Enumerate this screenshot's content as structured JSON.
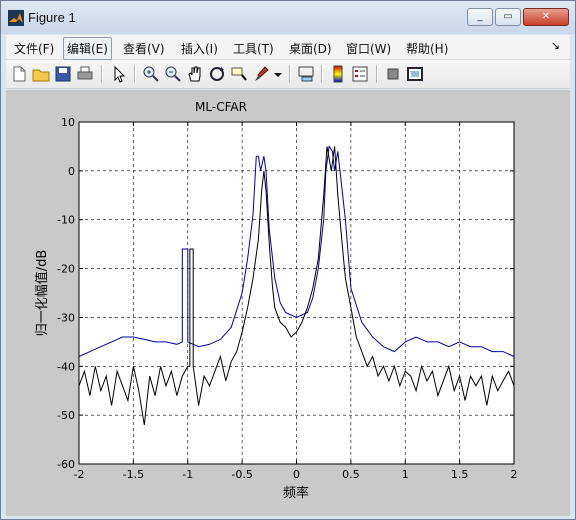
{
  "window": {
    "title": "Figure 1",
    "minimize_label": "_",
    "maximize_label": "▭",
    "close_label": "✕"
  },
  "menubar": {
    "items": [
      "文件(F)",
      "编辑(E)",
      "查看(V)",
      "插入(I)",
      "工具(T)",
      "桌面(D)",
      "窗口(W)",
      "帮助(H)"
    ],
    "active_item": "编辑(E)",
    "corner_glyph": "↘"
  },
  "toolbar": {
    "buttons": [
      "new-figure",
      "open-file",
      "save",
      "print",
      "edit-plot",
      "zoom-in",
      "zoom-out",
      "pan",
      "rotate-3d",
      "data-cursor",
      "brush",
      "brush-dropdown",
      "link-plot",
      "insert-colorbar",
      "insert-legend",
      "hide-plot-tools",
      "show-plot-tools"
    ]
  },
  "colors": {
    "series_blue": "#0000a8",
    "series_black": "#000000",
    "figure_background": "#c9c9c9",
    "axes_background": "#ffffff"
  },
  "chart_data": {
    "type": "line",
    "title": "ML-CFAR",
    "xlabel": "频率",
    "ylabel": "归一化幅值/dB",
    "xlim": [
      -2,
      2
    ],
    "ylim": [
      -60,
      10
    ],
    "xticks": [
      "-2",
      "-1.5",
      "-1",
      "-0.5",
      "0",
      "0.5",
      "1",
      "1.5",
      "2"
    ],
    "yticks": [
      "10",
      "0",
      "-10",
      "-20",
      "-30",
      "-40",
      "-50",
      "-60"
    ],
    "grid": true,
    "grid_style": "dashed",
    "series": [
      {
        "color": "blue",
        "x": [
          -2.0,
          -1.9,
          -1.8,
          -1.7,
          -1.6,
          -1.5,
          -1.4,
          -1.3,
          -1.2,
          -1.1,
          -1.05,
          -1.05,
          -1.0,
          -1.0,
          -0.9,
          -0.8,
          -0.7,
          -0.6,
          -0.5,
          -0.45,
          -0.4,
          -0.37,
          -0.35,
          -0.33,
          -0.3,
          -0.28,
          -0.25,
          -0.2,
          -0.15,
          -0.1,
          0.0,
          0.1,
          0.15,
          0.2,
          0.25,
          0.27,
          0.3,
          0.33,
          0.35,
          0.38,
          0.4,
          0.45,
          0.5,
          0.6,
          0.7,
          0.8,
          0.9,
          1.0,
          1.1,
          1.2,
          1.3,
          1.4,
          1.5,
          1.6,
          1.7,
          1.8,
          1.9,
          2.0
        ],
        "y": [
          -38,
          -37,
          -36,
          -35,
          -34,
          -34,
          -34.5,
          -35,
          -35,
          -35.5,
          -35,
          -16,
          -16,
          -35,
          -36,
          -35.5,
          -34.5,
          -32,
          -25,
          -18,
          -9,
          3,
          3,
          0,
          3,
          0,
          -12,
          -22,
          -27,
          -29,
          -30,
          -29,
          -26,
          -20,
          -10,
          0,
          5,
          4,
          0,
          4,
          0,
          -10,
          -24,
          -31,
          -34,
          -36,
          -37,
          -35,
          -34,
          -35,
          -35,
          -36,
          -35,
          -36,
          -36,
          -37,
          -37,
          -38
        ]
      },
      {
        "color": "black",
        "x": [
          -2.0,
          -1.95,
          -1.9,
          -1.85,
          -1.8,
          -1.75,
          -1.7,
          -1.65,
          -1.6,
          -1.55,
          -1.5,
          -1.45,
          -1.4,
          -1.35,
          -1.3,
          -1.25,
          -1.2,
          -1.15,
          -1.1,
          -1.05,
          -1.0,
          -0.98,
          -0.98,
          -0.95,
          -0.95,
          -0.9,
          -0.85,
          -0.8,
          -0.75,
          -0.7,
          -0.65,
          -0.6,
          -0.55,
          -0.5,
          -0.45,
          -0.4,
          -0.35,
          -0.32,
          -0.3,
          -0.28,
          -0.25,
          -0.22,
          -0.2,
          -0.15,
          -0.1,
          -0.05,
          0.0,
          0.05,
          0.1,
          0.15,
          0.2,
          0.25,
          0.28,
          0.32,
          0.35,
          0.38,
          0.42,
          0.45,
          0.5,
          0.55,
          0.6,
          0.65,
          0.7,
          0.75,
          0.8,
          0.85,
          0.9,
          0.95,
          1.0,
          1.05,
          1.1,
          1.15,
          1.2,
          1.25,
          1.3,
          1.35,
          1.4,
          1.45,
          1.5,
          1.55,
          1.6,
          1.65,
          1.7,
          1.75,
          1.8,
          1.85,
          1.9,
          1.95,
          2.0
        ],
        "y": [
          -44,
          -41,
          -46,
          -40,
          -45,
          -42,
          -48,
          -41,
          -44,
          -47,
          -40,
          -45,
          -52,
          -42,
          -46,
          -40,
          -44,
          -41,
          -46,
          -42,
          -40,
          -40,
          -16,
          -16,
          -40,
          -48,
          -42,
          -44,
          -41,
          -38,
          -43,
          -39,
          -37,
          -33,
          -28,
          -22,
          -14,
          -4,
          0,
          -4,
          -15,
          -24,
          -28,
          -31,
          -32,
          -34,
          -33,
          -31,
          -28,
          -24,
          -18,
          -5,
          5,
          0,
          5,
          -5,
          -15,
          -22,
          -28,
          -34,
          -37,
          -40,
          -38,
          -42,
          -40,
          -43,
          -40,
          -44,
          -41,
          -42,
          -45,
          -40,
          -43,
          -41,
          -46,
          -43,
          -40,
          -45,
          -42,
          -47,
          -42,
          -44,
          -42,
          -48,
          -42,
          -45,
          -43,
          -41,
          -44
        ]
      }
    ]
  }
}
